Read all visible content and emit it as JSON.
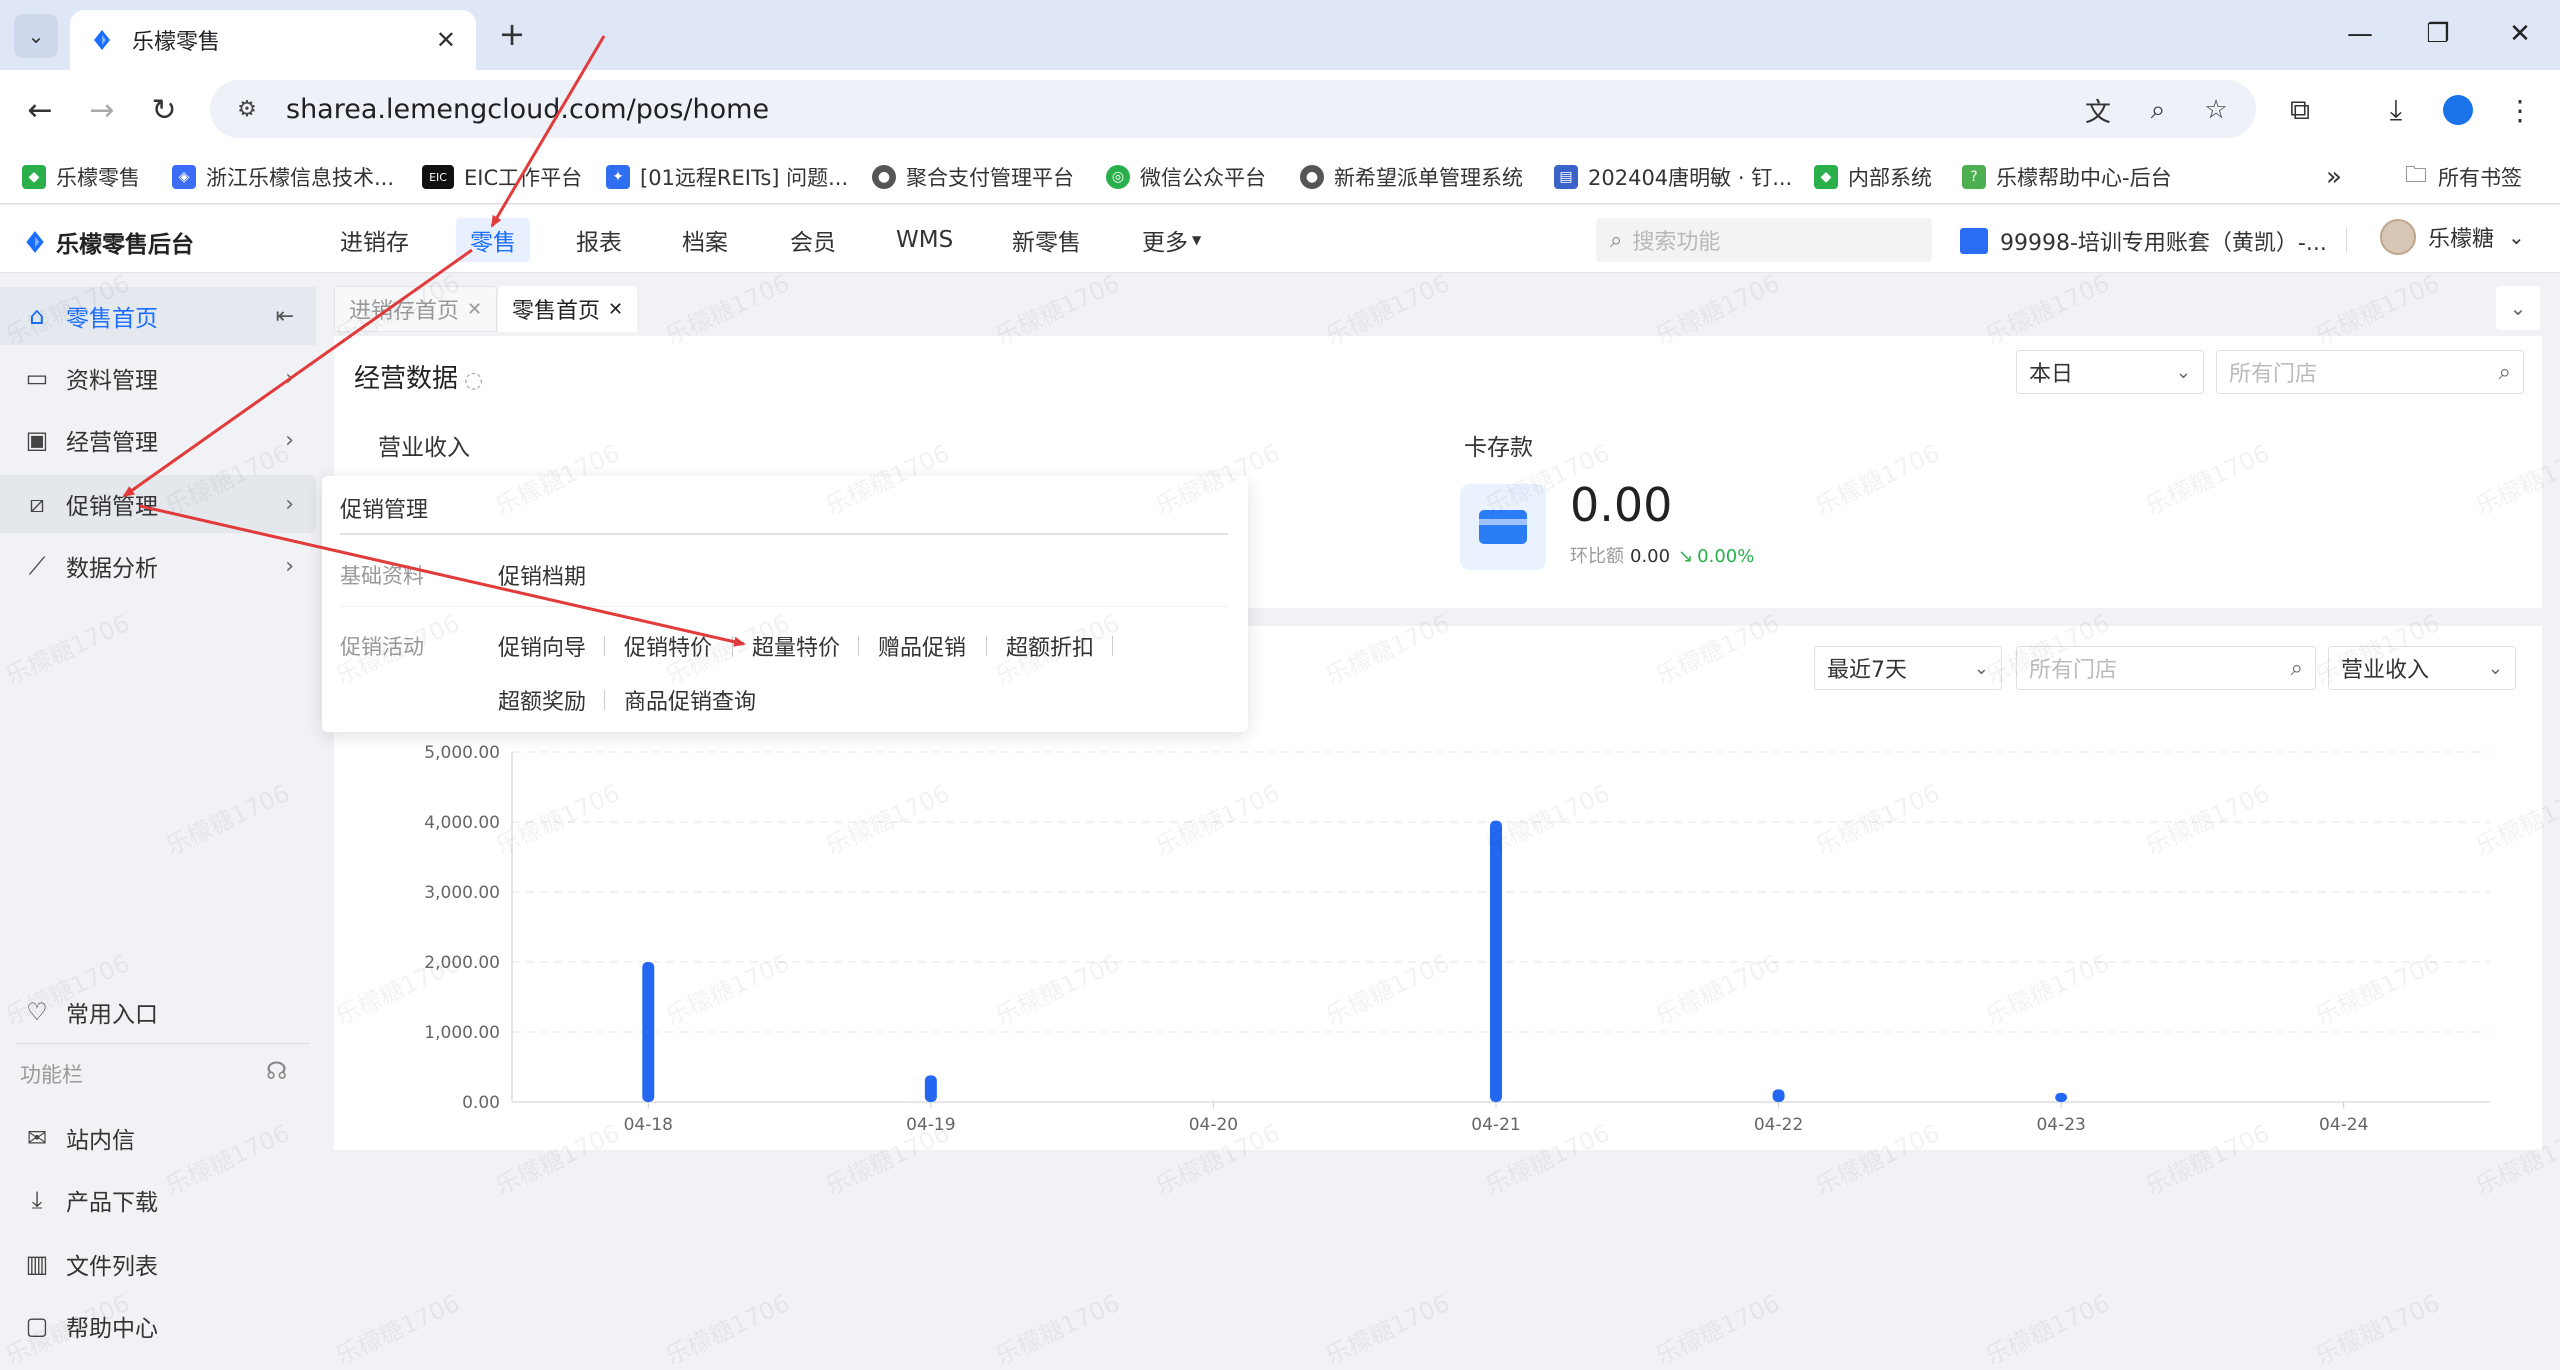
{
  "browser": {
    "tab_title": "乐檬零售",
    "url": "sharea.lemengcloud.com/pos/home",
    "bookmarks": [
      "乐檬零售",
      "浙江乐檬信息技术...",
      "EIC工作平台",
      "[01远程REITs] 问题...",
      "聚合支付管理平台",
      "微信公众平台",
      "新希望派单管理系统",
      "202404唐明敏 · 钉...",
      "内部系统",
      "乐檬帮助中心-后台"
    ],
    "bookmarks_more": "»",
    "all_bookmarks": "所有书签"
  },
  "app": {
    "logo": "乐檬零售后台",
    "nav": [
      "进销存",
      "零售",
      "报表",
      "档案",
      "会员",
      "WMS",
      "新零售",
      "更多"
    ],
    "active_nav": "零售",
    "search_placeholder": "搜索功能",
    "account": "99998-培训专用账套（黄凯）-...",
    "user": "乐檬糖"
  },
  "sidebar": {
    "items": [
      {
        "label": "零售首页",
        "icon": "home-icon"
      },
      {
        "label": "资料管理",
        "icon": "folder-icon"
      },
      {
        "label": "经营管理",
        "icon": "chart-board-icon"
      },
      {
        "label": "促销管理",
        "icon": "promo-icon"
      },
      {
        "label": "数据分析",
        "icon": "line-chart-icon"
      }
    ],
    "favorite": "常用入口",
    "section_label": "功能栏",
    "bottom_items": [
      "站内信",
      "产品下载",
      "文件列表",
      "帮助中心"
    ]
  },
  "page_tabs": [
    {
      "label": "进销存首页",
      "active": false
    },
    {
      "label": "零售首页",
      "active": true
    }
  ],
  "business": {
    "title": "经营数据",
    "period": "本日",
    "store_placeholder": "所有门店",
    "revenue_label": "营业收入",
    "card_label": "卡存款",
    "card_value": "0.00",
    "card_compare_label": "环比额",
    "card_compare_value": "0.00",
    "card_compare_pct": "0.00%"
  },
  "chart_panel": {
    "period": "最近7天",
    "store_placeholder": "所有门店",
    "metric": "营业收入"
  },
  "promo_menu": {
    "title": "促销管理",
    "basic_label": "基础资料",
    "basic_links": [
      "促销档期"
    ],
    "activity_label": "促销活动",
    "activity_links": [
      "促销向导",
      "促销特价",
      "超量特价",
      "赠品促销",
      "超额折扣",
      "超额奖励",
      "商品促销查询"
    ]
  },
  "watermark": "乐檬糖1706",
  "colors": {
    "accent": "#1a6dff",
    "bar": "#2468f2",
    "arrow": "#e23b3b",
    "positive": "#27b14a"
  },
  "chart_data": {
    "type": "bar",
    "categories": [
      "04-18",
      "04-19",
      "04-20",
      "04-21",
      "04-22",
      "04-23",
      "04-24"
    ],
    "values": [
      2000,
      380,
      0,
      4020,
      180,
      130,
      0
    ],
    "ylim": [
      0,
      5000
    ],
    "yticks": [
      "5,000.00",
      "4,000.00",
      "3,000.00",
      "2,000.00",
      "1,000.00",
      "0.00"
    ],
    "grid": true
  }
}
